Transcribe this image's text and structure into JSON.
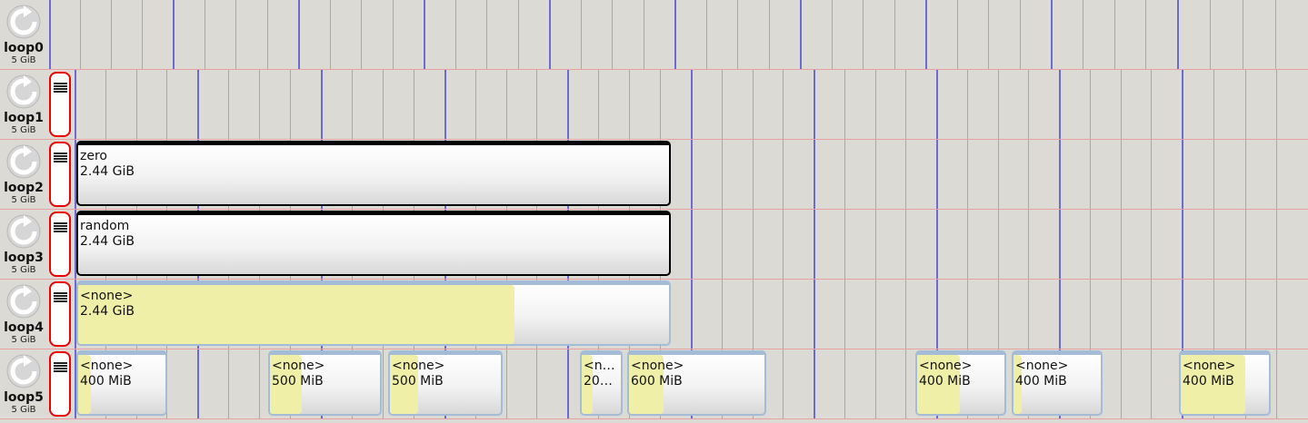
{
  "devices": [
    {
      "name": "loop0",
      "size": "5 GiB",
      "partitions": []
    },
    {
      "name": "loop1",
      "size": "5 GiB",
      "partitions": []
    },
    {
      "name": "loop2",
      "size": "5 GiB",
      "partitions": [
        {
          "label": "zero",
          "size": "2.44 GiB",
          "style": "dark"
        }
      ]
    },
    {
      "name": "loop3",
      "size": "5 GiB",
      "partitions": [
        {
          "label": "random",
          "size": "2.44 GiB",
          "style": "dark"
        }
      ]
    },
    {
      "name": "loop4",
      "size": "5 GiB",
      "partitions": [
        {
          "label": "<none>",
          "size": "2.44 GiB",
          "style": "light"
        }
      ]
    },
    {
      "name": "loop5",
      "size": "5 GiB",
      "partitions": [
        {
          "label": "<none>",
          "size": "400 MiB",
          "style": "light"
        },
        {
          "label": "<none>",
          "size": "500 MiB",
          "style": "light"
        },
        {
          "label": "<none>",
          "size": "500 MiB",
          "style": "light"
        },
        {
          "label": "<n…",
          "size": "20…",
          "style": "light"
        },
        {
          "label": "<none>",
          "size": "600 MiB",
          "style": "light"
        },
        {
          "label": "<none>",
          "size": "400 MiB",
          "style": "light"
        },
        {
          "label": "<none>",
          "size": "400 MiB",
          "style": "light"
        },
        {
          "label": "<none>",
          "size": "400 MiB",
          "style": "light"
        }
      ]
    }
  ],
  "icons": {
    "device": "refresh-icon",
    "header": "partition-table-icon"
  },
  "colors": {
    "selected_border": "#ee0000",
    "major_grid": "#6b6bd4",
    "fill_used": "#efefa8",
    "partition_border": "#a5bcd6"
  }
}
